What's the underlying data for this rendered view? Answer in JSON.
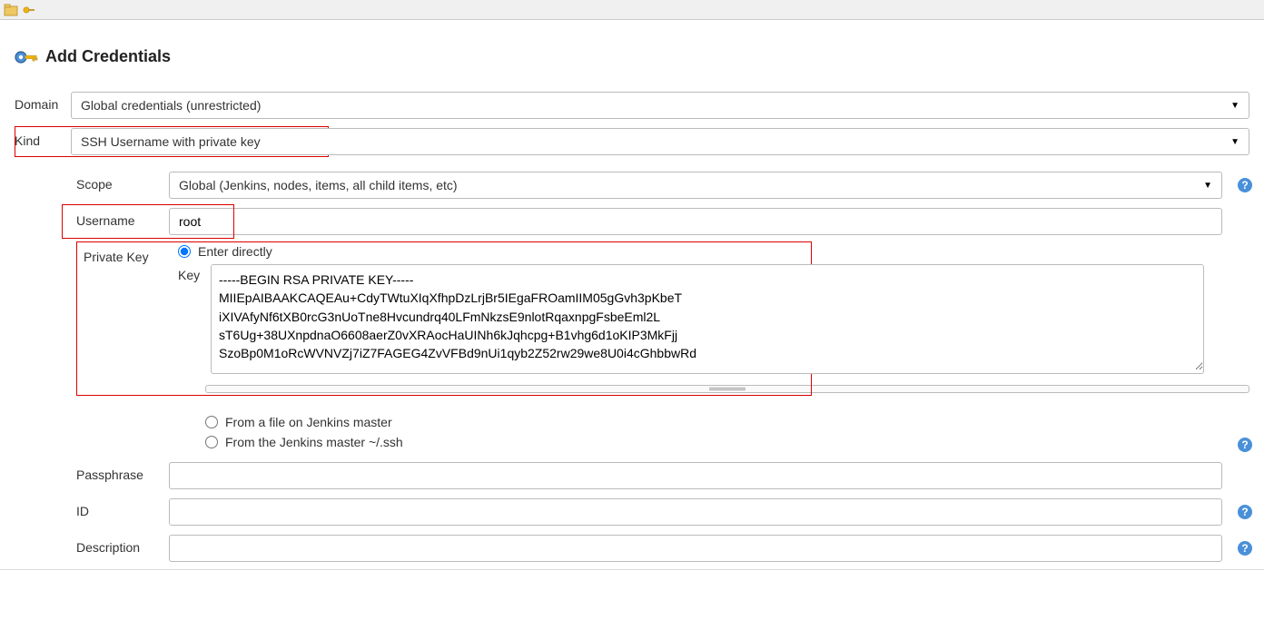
{
  "heading": "Add Credentials",
  "fields": {
    "domain": {
      "label": "Domain",
      "value": "Global credentials (unrestricted)"
    },
    "kind": {
      "label": "Kind",
      "value": "SSH Username with private key"
    },
    "scope": {
      "label": "Scope",
      "value": "Global (Jenkins, nodes, items, all child items, etc)"
    },
    "username": {
      "label": "Username",
      "value": "root"
    },
    "privateKey": {
      "label": "Private Key",
      "option_enter": "Enter directly",
      "option_file": "From a file on Jenkins master",
      "option_ssh": "From the Jenkins master ~/.ssh",
      "key_label": "Key",
      "key_value": "-----BEGIN RSA PRIVATE KEY-----\nMIIEpAIBAAKCAQEAu+CdyTWtuXIqXfhpDzLrjBr5IEgaFROamIIM05gGvh3pKbeT\niXIVAfyNf6tXB0rcG3nUoTne8Hvcundrq40LFmNkzsE9nlotRqaxnpgFsbeEml2L\nsT6Ug+38UXnpdnaO6608aerZ0vXRAocHaUINh6kJqhcpg+B1vhg6d1oKIP3MkFjj\nSzoBp0M1oRcWVNVZj7iZ7FAGEG4ZvVFBd9nUi1qyb2Z52rw29we8U0i4cGhbbwRd"
    },
    "passphrase": {
      "label": "Passphrase",
      "value": ""
    },
    "id": {
      "label": "ID",
      "value": ""
    },
    "description": {
      "label": "Description",
      "value": ""
    }
  }
}
